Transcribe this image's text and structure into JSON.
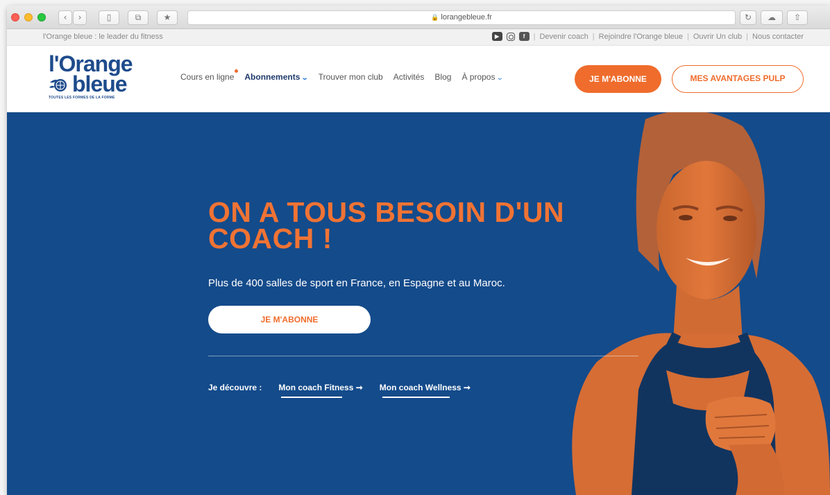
{
  "browser": {
    "url": "lorangebleue.fr",
    "lock_icon": "lock-icon"
  },
  "utility": {
    "tagline": "l'Orange bleue : le leader du fitness",
    "links": [
      "Devenir coach",
      "Rejoindre l'Orange bleue",
      "Ouvrir Un club",
      "Nous contacter"
    ],
    "separator": "|"
  },
  "logo": {
    "line1": "l'Orange",
    "line2": "bleue",
    "tagline": "TOUTES LES FORMES DE LA FORME"
  },
  "nav": {
    "items": [
      {
        "label": "Cours en ligne"
      },
      {
        "label": "Abonnements"
      },
      {
        "label": "Trouver mon club"
      },
      {
        "label": "Activités"
      },
      {
        "label": "Blog"
      },
      {
        "label": "À propos"
      }
    ],
    "subscribe_button": "JE M'ABONNE",
    "pulp_button": "MES AVANTAGES PULP"
  },
  "hero": {
    "title": "ON A TOUS BESOIN D'UN COACH !",
    "subtitle": "Plus de 400 salles de sport en France, en Espagne et au Maroc.",
    "cta": "JE M'ABONNE",
    "discover_label": "Je découvre :",
    "link_fitness": "Mon coach Fitness ➞",
    "link_wellness": "Mon coach Wellness ➞"
  },
  "colors": {
    "brand_orange": "#ef6c2c",
    "brand_blue": "#144b8b",
    "logo_blue": "#1e4b8c"
  }
}
